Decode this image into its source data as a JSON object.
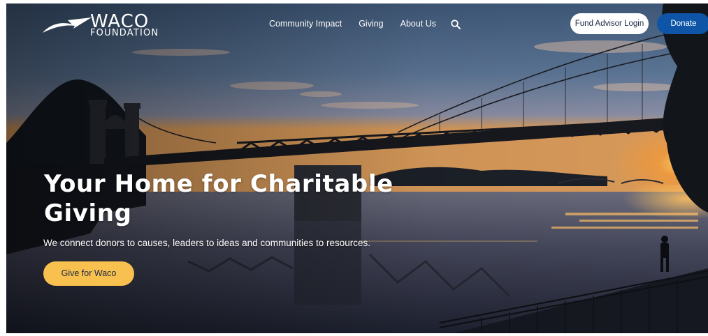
{
  "brand": {
    "name": "WACO",
    "subtitle": "FOUNDATION"
  },
  "nav": {
    "items": [
      {
        "label": "Community Impact"
      },
      {
        "label": "Giving"
      },
      {
        "label": "About Us"
      }
    ],
    "search_icon": "magnifier-icon"
  },
  "header_actions": {
    "login_label": "Fund Advisor Login",
    "donate_label": "Donate"
  },
  "hero": {
    "headline": "Your Home for Charitable Giving",
    "tagline": "We connect donors to causes, leaders to ideas and communities to resources.",
    "cta_label": "Give for Waco",
    "image_subject": "bridge-at-sunset-photo"
  },
  "colors": {
    "donate_button": "#0e55a8",
    "cta_button": "#f7c04f",
    "login_button": "#ffffff"
  }
}
